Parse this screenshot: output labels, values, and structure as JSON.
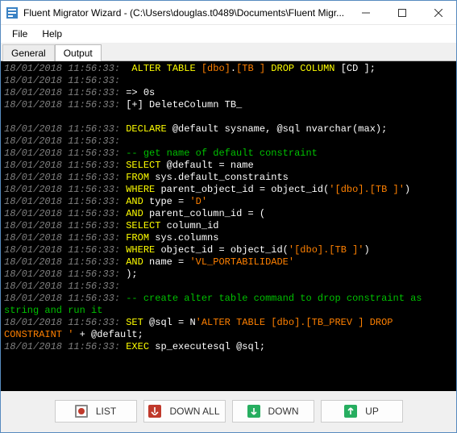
{
  "window": {
    "title": "Fluent Migrator Wizard - (C:\\Users\\douglas.t0489\\Documents\\Fluent Migr..."
  },
  "menu": {
    "file": "File",
    "help": "Help"
  },
  "tabs": {
    "general": "General",
    "output": "Output"
  },
  "console": {
    "lines": [
      {
        "ts": "18/01/2018 11:56:33: ",
        "segs": [
          {
            "c": "kw",
            "t": " ALTER TABLE "
          },
          {
            "c": "str",
            "t": "[dbo]"
          },
          {
            "c": "",
            "t": "."
          },
          {
            "c": "str",
            "t": "[TB ]"
          },
          {
            "c": "kw",
            "t": " DROP COLUMN "
          },
          {
            "c": "",
            "t": "[CD ]"
          },
          {
            "c": "",
            "t": ";"
          }
        ]
      },
      {
        "ts": "18/01/2018 11:56:33: ",
        "segs": []
      },
      {
        "ts": "18/01/2018 11:56:33: ",
        "segs": [
          {
            "c": "",
            "t": "=> 0s"
          }
        ]
      },
      {
        "ts": "18/01/2018 11:56:33: ",
        "segs": [
          {
            "c": "",
            "t": "[+] DeleteColumn TB_"
          }
        ]
      },
      {
        "ts": "",
        "segs": []
      },
      {
        "ts": "18/01/2018 11:56:33: ",
        "segs": [
          {
            "c": "kw",
            "t": "DECLARE"
          },
          {
            "c": "",
            "t": " @default sysname, @sql nvarchar(max);"
          }
        ]
      },
      {
        "ts": "18/01/2018 11:56:33: ",
        "segs": []
      },
      {
        "ts": "18/01/2018 11:56:33: ",
        "segs": [
          {
            "c": "comment",
            "t": "-- get name of default constraint"
          }
        ]
      },
      {
        "ts": "18/01/2018 11:56:33: ",
        "segs": [
          {
            "c": "kw",
            "t": "SELECT"
          },
          {
            "c": "",
            "t": " @default = name"
          }
        ]
      },
      {
        "ts": "18/01/2018 11:56:33: ",
        "segs": [
          {
            "c": "kw",
            "t": "FROM"
          },
          {
            "c": "",
            "t": " sys.default_constraints"
          }
        ]
      },
      {
        "ts": "18/01/2018 11:56:33: ",
        "segs": [
          {
            "c": "kw",
            "t": "WHERE"
          },
          {
            "c": "",
            "t": " parent_object_id = object_id("
          },
          {
            "c": "str",
            "t": "'[dbo].[TB ]'"
          },
          {
            "c": "",
            "t": ")"
          }
        ]
      },
      {
        "ts": "18/01/2018 11:56:33: ",
        "segs": [
          {
            "c": "kw",
            "t": "AND"
          },
          {
            "c": "",
            "t": " type = "
          },
          {
            "c": "str",
            "t": "'D'"
          }
        ]
      },
      {
        "ts": "18/01/2018 11:56:33: ",
        "segs": [
          {
            "c": "kw",
            "t": "AND"
          },
          {
            "c": "",
            "t": " parent_column_id = ("
          }
        ]
      },
      {
        "ts": "18/01/2018 11:56:33: ",
        "segs": [
          {
            "c": "kw",
            "t": "SELECT"
          },
          {
            "c": "",
            "t": " column_id"
          }
        ]
      },
      {
        "ts": "18/01/2018 11:56:33: ",
        "segs": [
          {
            "c": "kw",
            "t": "FROM"
          },
          {
            "c": "",
            "t": " sys.columns"
          }
        ]
      },
      {
        "ts": "18/01/2018 11:56:33: ",
        "segs": [
          {
            "c": "kw",
            "t": "WHERE"
          },
          {
            "c": "",
            "t": " object_id = object_id("
          },
          {
            "c": "str",
            "t": "'[dbo].[TB ]'"
          },
          {
            "c": "",
            "t": ")"
          }
        ]
      },
      {
        "ts": "18/01/2018 11:56:33: ",
        "segs": [
          {
            "c": "kw",
            "t": "AND"
          },
          {
            "c": "",
            "t": " name = "
          },
          {
            "c": "str",
            "t": "'VL_PORTABILIDADE'"
          }
        ]
      },
      {
        "ts": "18/01/2018 11:56:33: ",
        "segs": [
          {
            "c": "",
            "t": ");"
          }
        ]
      },
      {
        "ts": "18/01/2018 11:56:33: ",
        "segs": []
      },
      {
        "ts": "18/01/2018 11:56:33: ",
        "segs": [
          {
            "c": "comment",
            "t": "-- create alter table command to drop constraint as string and run it"
          }
        ]
      },
      {
        "ts": "18/01/2018 11:56:33: ",
        "segs": [
          {
            "c": "kw",
            "t": "SET"
          },
          {
            "c": "",
            "t": " @sql = N"
          },
          {
            "c": "str",
            "t": "'ALTER TABLE [dbo].[TB_PREV ] DROP CONSTRAINT '"
          },
          {
            "c": "",
            "t": " + @default;"
          }
        ]
      },
      {
        "ts": "18/01/2018 11:56:33: ",
        "segs": [
          {
            "c": "kw",
            "t": "EXEC"
          },
          {
            "c": "",
            "t": " sp_executesql @sql;"
          }
        ]
      }
    ]
  },
  "buttons": {
    "list": "LIST",
    "down_all": "DOWN ALL",
    "down": "DOWN",
    "up": "UP"
  }
}
